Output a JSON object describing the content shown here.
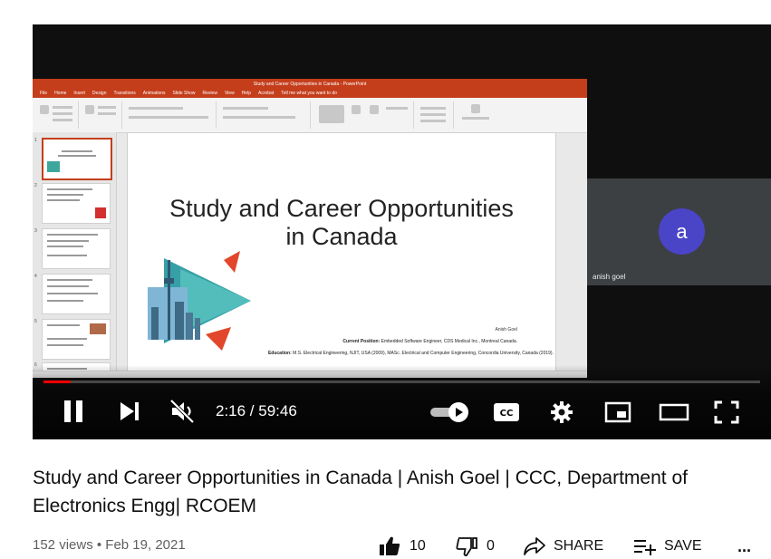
{
  "ppt": {
    "window_title": "Study and Career Opportunities in Canada - PowerPoint",
    "menu": [
      "File",
      "Home",
      "Insert",
      "Design",
      "Transitions",
      "Animations",
      "Slide Show",
      "Review",
      "View",
      "Help",
      "Acrobat",
      "Tell me what you want to do"
    ],
    "slide": {
      "title": "Study and Career Opportunities in Canada",
      "author": "Anish Goel",
      "position_label": "Current Position:",
      "position": "Embedded Software Engineer, CDS Medical Inc., Montreal Canada.",
      "education_label": "Education:",
      "education": "M.S. Electrical Engineering, NJIT, USA (2009), MASc. Electrical and Computer Engineering, Concordia University, Canada (2019)."
    },
    "thumbnails": [
      "1",
      "2",
      "3",
      "4",
      "5",
      "6"
    ]
  },
  "meet": {
    "participant_initial": "a",
    "participant_name": "anish goel",
    "avatar_color": "#4a44c6"
  },
  "player": {
    "time": "2:16 / 59:46",
    "progress": 0.038,
    "accent": "#ff0000"
  },
  "video": {
    "title": "Study and Career Opportunities in Canada | Anish Goel | CCC, Department of Electronics Engg| RCOEM",
    "views": "152 views • Feb 19, 2021",
    "likes": "10",
    "dislikes": "0",
    "share_label": "SHARE",
    "save_label": "SAVE",
    "more_label": "..."
  }
}
